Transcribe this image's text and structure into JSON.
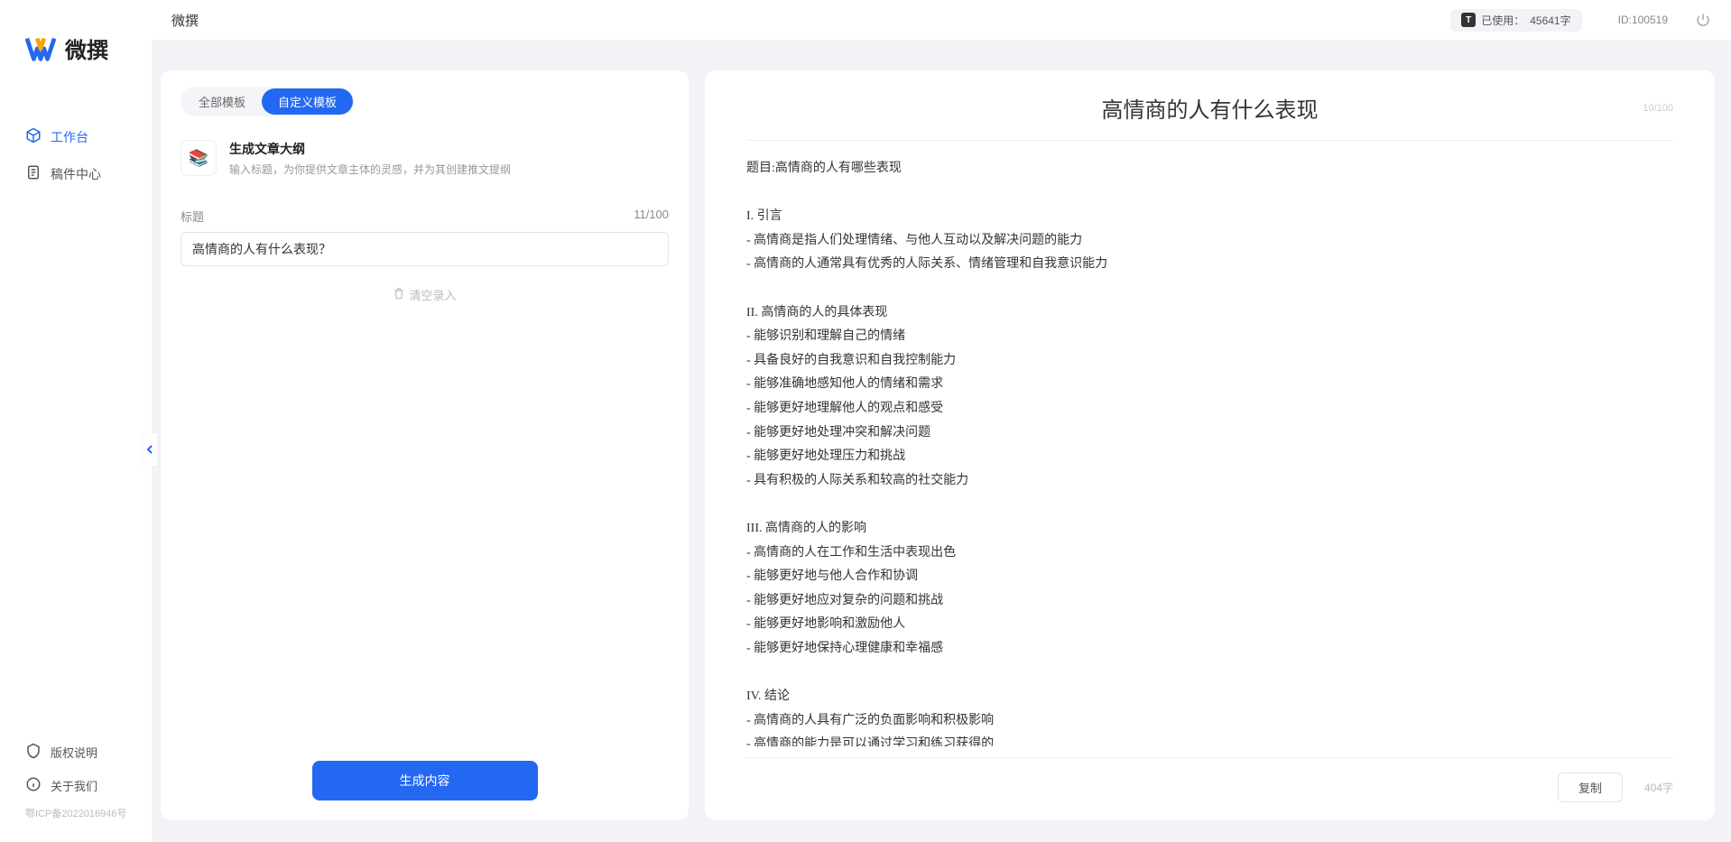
{
  "app": {
    "name": "微撰",
    "title": "微撰"
  },
  "sidebar": {
    "nav": [
      {
        "label": "工作台",
        "icon": "cube"
      },
      {
        "label": "稿件中心",
        "icon": "doc"
      }
    ],
    "footer": [
      {
        "label": "版权说明",
        "icon": "shield"
      },
      {
        "label": "关于我们",
        "icon": "info"
      }
    ],
    "icp": "鄂ICP备2022016946号"
  },
  "topbar": {
    "usage_label": "已使用：",
    "usage_value": "45641字",
    "badge_letter": "T",
    "id_label": "ID:100519"
  },
  "tabs": {
    "all": "全部模板",
    "custom": "自定义模板"
  },
  "template": {
    "title": "生成文章大纲",
    "desc": "输入标题，为你提供文章主体的灵感，并为其创建推文提纲",
    "icon_glyph": "📚"
  },
  "form": {
    "label": "标题",
    "counter": "11/100",
    "value": "高情商的人有什么表现？",
    "clear_text": "清空录入"
  },
  "actions": {
    "generate": "生成内容",
    "copy": "复制"
  },
  "output": {
    "title": "高情商的人有什么表现",
    "title_count": "10/100",
    "char_count": "404字",
    "body": "题目:高情商的人有哪些表现\n\nI. 引言\n- 高情商是指人们处理情绪、与他人互动以及解决问题的能力\n- 高情商的人通常具有优秀的人际关系、情绪管理和自我意识能力\n\nII. 高情商的人的具体表现\n- 能够识别和理解自己的情绪\n- 具备良好的自我意识和自我控制能力\n- 能够准确地感知他人的情绪和需求\n- 能够更好地理解他人的观点和感受\n- 能够更好地处理冲突和解决问题\n- 能够更好地处理压力和挑战\n- 具有积极的人际关系和较高的社交能力\n\nIII. 高情商的人的影响\n- 高情商的人在工作和生活中表现出色\n- 能够更好地与他人合作和协调\n- 能够更好地应对复杂的问题和挑战\n- 能够更好地影响和激励他人\n- 能够更好地保持心理健康和幸福感\n\nIV. 结论\n- 高情商的人具有广泛的负面影响和积极影响\n- 高情商的能力是可以通过学习和练习获得的\n- 培养和提高高情商的能力对于个人的职业发展和生活质量至关重要。"
  }
}
